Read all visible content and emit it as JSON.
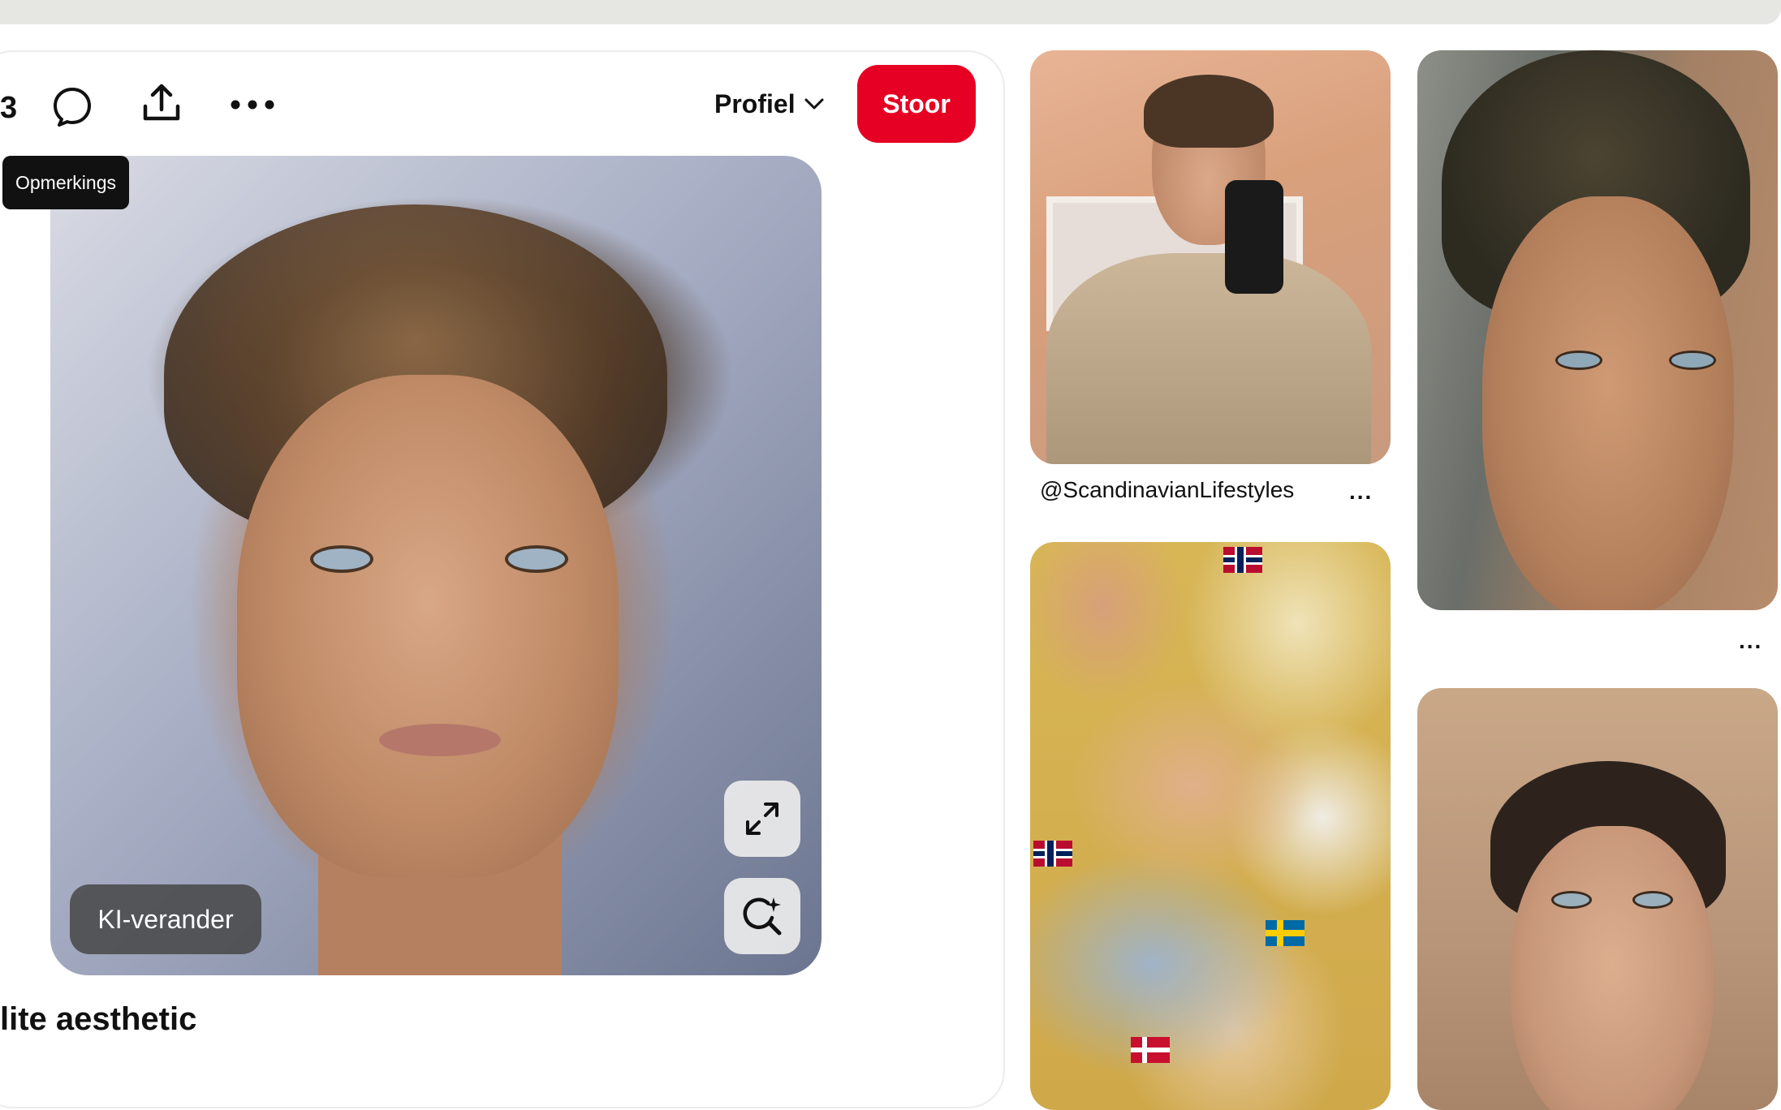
{
  "toolbar": {
    "partial_count": "3",
    "comments_tooltip": "Opmerkings",
    "profile_label": "Profiel",
    "save_label": "Stoor"
  },
  "pin": {
    "ai_modify_label": "KI-verander",
    "title": "lite aesthetic"
  },
  "feed": {
    "items": [
      {
        "caption": "@ScandinavianLifestyles",
        "more": "..."
      },
      {
        "caption": "",
        "more": "..."
      }
    ]
  },
  "colors": {
    "save_button": "#e60023",
    "tooltip_bg": "#111111",
    "top_strip": "#e6e6e3"
  },
  "icons": [
    "comment-icon",
    "share-icon",
    "more-icon",
    "chevron-down-icon",
    "expand-icon",
    "visual-search-icon"
  ]
}
